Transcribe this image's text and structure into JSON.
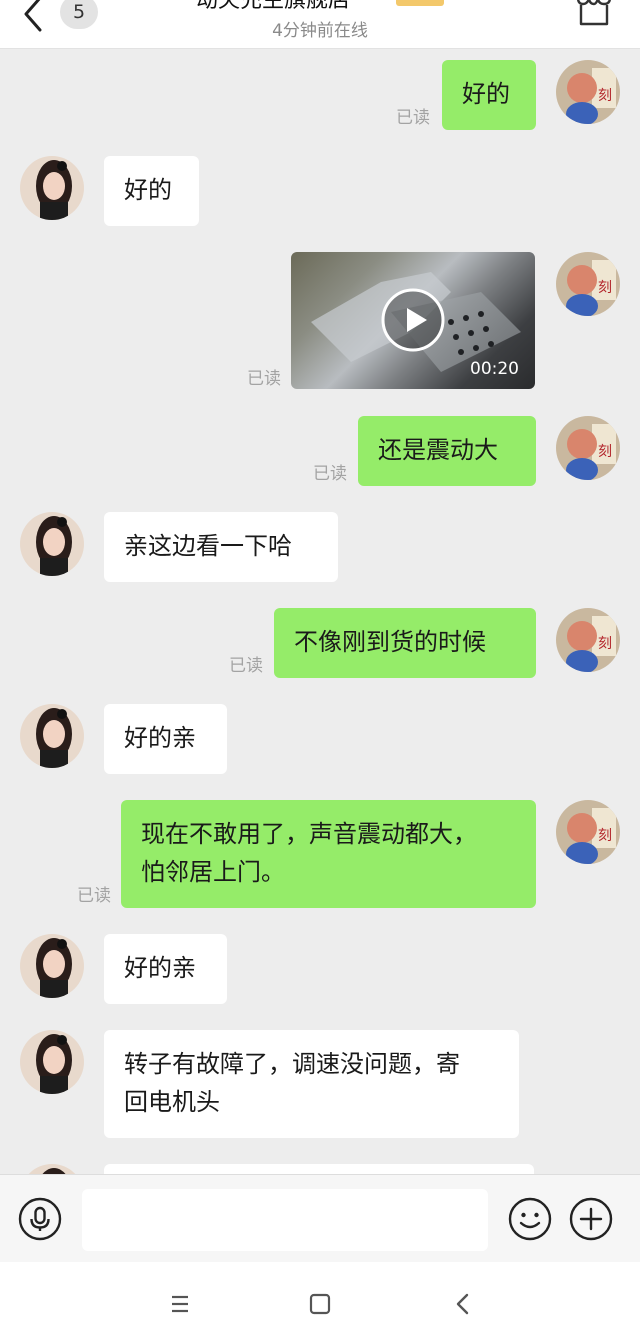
{
  "header": {
    "back_count": "5",
    "title": "动夫充主旗舰店",
    "status": "4分钟前在线"
  },
  "messages": [
    {
      "side": "out",
      "text": "好的",
      "read": "已读"
    },
    {
      "side": "in",
      "text": "好的"
    },
    {
      "side": "out",
      "type": "video",
      "duration": "00:20",
      "read": "已读"
    },
    {
      "side": "out",
      "text": "还是震动大",
      "read": "已读"
    },
    {
      "side": "in",
      "text": "亲这边看一下哈"
    },
    {
      "side": "out",
      "text": "不像刚到货的时候",
      "read": "已读"
    },
    {
      "side": "in",
      "text": "好的亲"
    },
    {
      "side": "out",
      "text": "现在不敢用了，声音震动都大，\n怕邻居上门。",
      "read": "已读"
    },
    {
      "side": "in",
      "text": "好的亲"
    },
    {
      "side": "in",
      "text": "转子有故障了，调速没问题，寄\n回电机头"
    }
  ],
  "input": {
    "placeholder": "",
    "value": ""
  },
  "icons": {
    "back": "chevron-left-icon",
    "shop": "shop-icon",
    "voice": "microphone-icon",
    "emoji": "emoji-icon",
    "plus": "plus-icon",
    "play": "play-icon",
    "nav_menu": "menu-icon",
    "nav_home": "square-home-icon",
    "nav_back": "nav-back-icon"
  },
  "colors": {
    "outgoing_bubble": "#95ec69",
    "incoming_bubble": "#ffffff",
    "background": "#ededed",
    "read_label": "#a3a3a3"
  }
}
